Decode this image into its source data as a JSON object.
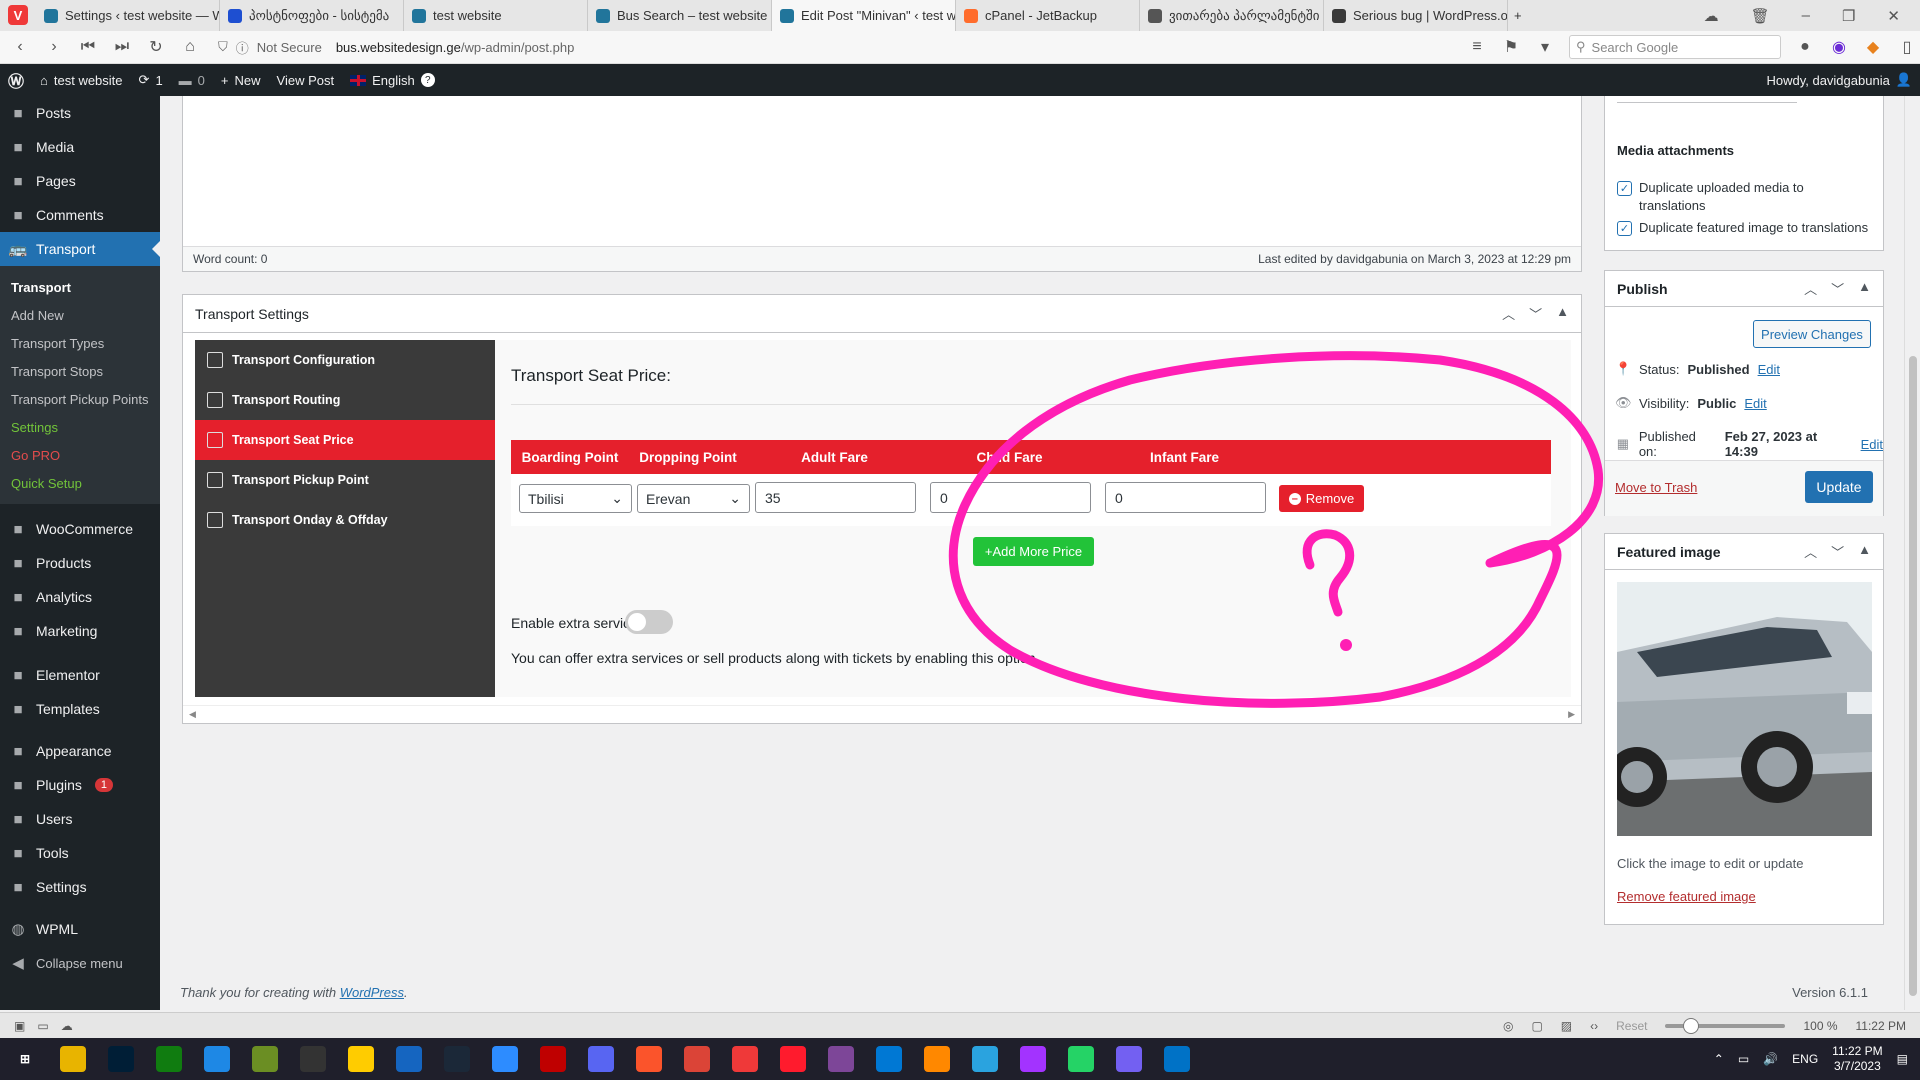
{
  "browser": {
    "tabs": [
      {
        "title": "Settings ‹ test website — W",
        "color": "#21759b",
        "active": false
      },
      {
        "title": "პოსტნოფები - სისტემა",
        "color": "#1e4fd1",
        "active": false
      },
      {
        "title": "test website",
        "color": "#21759b",
        "active": false
      },
      {
        "title": "Bus Search – test website",
        "color": "#21759b",
        "active": false
      },
      {
        "title": "Edit Post \"Minivan\" ‹ test w",
        "color": "#21759b",
        "active": true
      },
      {
        "title": "cPanel - JetBackup",
        "color": "#ff6c2c",
        "active": false
      },
      {
        "title": "ვითარება პარლამენტში",
        "color": "#555555",
        "active": false
      },
      {
        "title": "Serious bug | WordPress.or",
        "color": "#3a3a3a",
        "active": false
      }
    ],
    "security_label": "Not Secure",
    "url_host": "bus.websitedesign.ge",
    "url_path": "/wp-admin/post.php",
    "search_placeholder": "Search Google",
    "zoom_reset": "Reset",
    "zoom_level": "100 %",
    "status_time": "11:22 PM"
  },
  "adminbar": {
    "site_name": "test website",
    "updates_count": "1",
    "comments_count": "0",
    "new_label": "New",
    "view_post": "View Post",
    "language": "English",
    "howdy": "Howdy, davidgabunia"
  },
  "sidebar": {
    "menu_top": [
      {
        "label": "Posts",
        "icon": "pushpin-icon"
      },
      {
        "label": "Media",
        "icon": "media-icon"
      },
      {
        "label": "Pages",
        "icon": "pages-icon"
      },
      {
        "label": "Comments",
        "icon": "comments-icon"
      }
    ],
    "current": "Transport",
    "submenu": [
      {
        "label": "Transport",
        "cls": "cur"
      },
      {
        "label": "Add New",
        "cls": ""
      },
      {
        "label": "Transport Types",
        "cls": ""
      },
      {
        "label": "Transport Stops",
        "cls": ""
      },
      {
        "label": "Transport Pickup Points",
        "cls": ""
      },
      {
        "label": "Settings",
        "cls": "green"
      },
      {
        "label": "Go PRO",
        "cls": "red"
      },
      {
        "label": "Quick Setup",
        "cls": "green"
      }
    ],
    "menu_commerce": [
      {
        "label": "WooCommerce",
        "icon": "woocommerce-icon"
      },
      {
        "label": "Products",
        "icon": "products-icon"
      },
      {
        "label": "Analytics",
        "icon": "analytics-icon"
      },
      {
        "label": "Marketing",
        "icon": "marketing-icon"
      }
    ],
    "menu_elementor": [
      {
        "label": "Elementor",
        "icon": "elementor-icon"
      },
      {
        "label": "Templates",
        "icon": "templates-icon"
      }
    ],
    "menu_admin": [
      {
        "label": "Appearance",
        "icon": "appearance-icon"
      },
      {
        "label": "Plugins",
        "icon": "plugins-icon",
        "badge": "1"
      },
      {
        "label": "Users",
        "icon": "users-icon"
      },
      {
        "label": "Tools",
        "icon": "tools-icon"
      },
      {
        "label": "Settings",
        "icon": "settings-icon"
      }
    ],
    "wpml": "WPML",
    "collapse": "Collapse menu"
  },
  "editor": {
    "word_count": "Word count: 0",
    "last_edited": "Last edited by davidgabunia on March 3, 2023 at 12:29 pm"
  },
  "transport_settings": {
    "title": "Transport Settings",
    "nav": [
      {
        "label": "Transport Configuration",
        "icon": "config-icon",
        "active": false
      },
      {
        "label": "Transport Routing",
        "icon": "routing-icon",
        "active": false
      },
      {
        "label": "Transport Seat Price",
        "icon": "price-icon",
        "active": true
      },
      {
        "label": "Transport Pickup Point",
        "icon": "flag-icon",
        "active": false
      },
      {
        "label": "Transport Onday & Offday",
        "icon": "calendar-icon",
        "active": false
      }
    ],
    "panel_title": "Transport Seat Price:",
    "columns": [
      "Boarding Point",
      "Dropping Point",
      "Adult Fare",
      "Child Fare",
      "Infant Fare"
    ],
    "row": {
      "boarding": "Tbilisi",
      "dropping": "Erevan",
      "adult": "35",
      "child": "0",
      "infant": "0"
    },
    "remove_label": "Remove",
    "add_more_label": "+Add More Price",
    "extra_label": "Enable extra service :",
    "extra_enabled": false,
    "extra_desc": "You can offer extra services or sell products along with tickets by enabling this option.",
    "annotation_mark": "?",
    "annotation_color": "#ff1fb4"
  },
  "media": {
    "title": "Media attachments",
    "dup_media": "Duplicate uploaded media to translations",
    "dup_featured": "Duplicate featured image to translations"
  },
  "publish": {
    "title": "Publish",
    "preview": "Preview Changes",
    "status_label": "Status:",
    "status_value": "Published",
    "visibility_label": "Visibility:",
    "visibility_value": "Public",
    "published_label": "Published on:",
    "published_value": "Feb 27, 2023 at 14:39",
    "edit": "Edit",
    "trash": "Move to Trash",
    "update": "Update"
  },
  "featured": {
    "title": "Featured image",
    "hint": "Click the image to edit or update",
    "remove": "Remove featured image"
  },
  "footer": {
    "thanks_prefix": "Thank you for creating with ",
    "wordpress_link": "WordPress",
    "thanks_suffix": ".",
    "version": "Version 6.1.1"
  },
  "taskbar": {
    "lang": "ENG",
    "time": "11:22 PM",
    "date": "3/7/2023",
    "apps": [
      "folder",
      "Ps",
      "xbox",
      "app",
      "app",
      "steam",
      "app",
      "mail",
      "steam",
      "zoom",
      "Fz",
      "discord",
      "brave",
      "chrome",
      "vivaldi",
      "opera",
      "tor",
      "edge",
      "vlc",
      "telegram",
      "messenger",
      "whatsapp",
      "viber",
      "outlook"
    ]
  },
  "colors": {
    "wp_dark": "#1d2327",
    "wp_blue": "#2271b1",
    "plugin_red": "#e5202c",
    "add_green": "#22c339"
  }
}
